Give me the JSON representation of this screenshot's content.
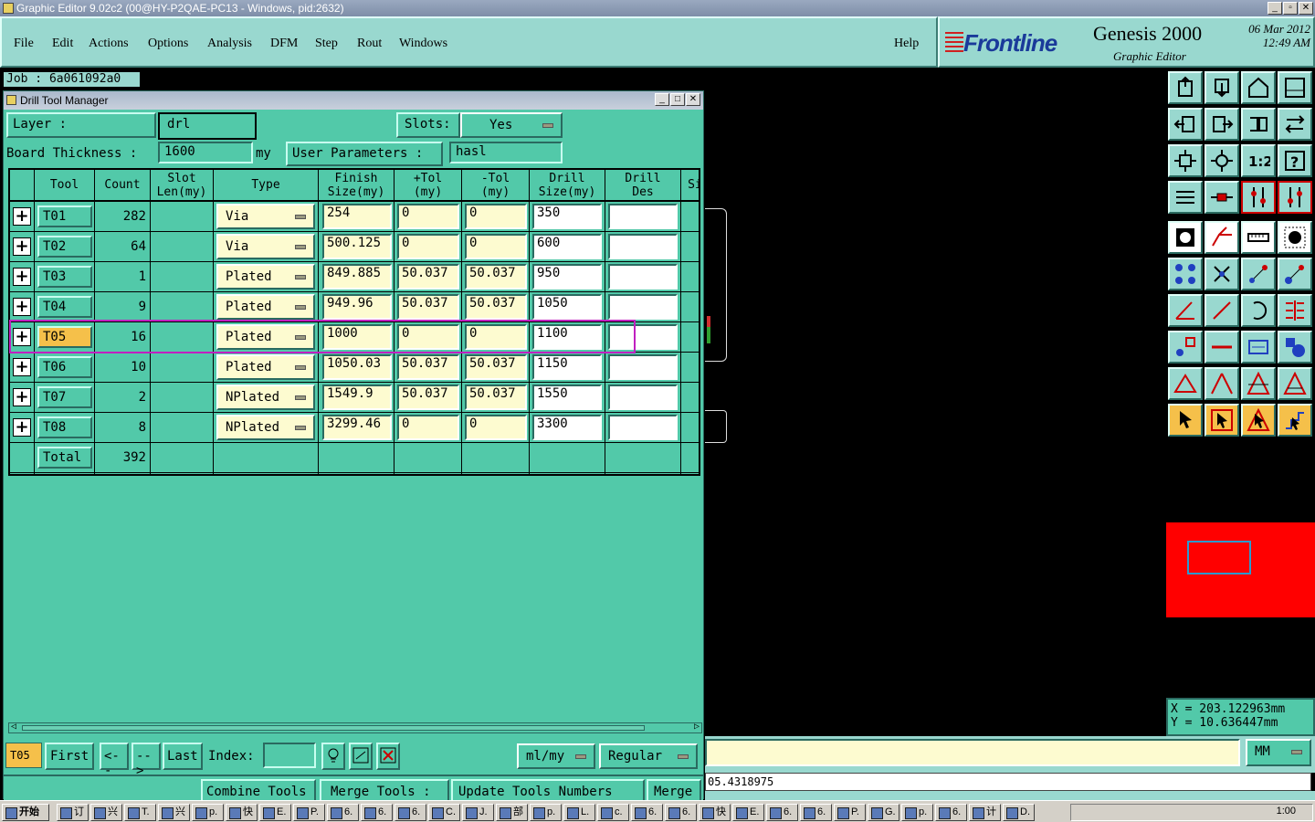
{
  "window": {
    "title": "Graphic Editor 9.02c2 (00@HY-P2QAE-PC13 - Windows, pid:2632)"
  },
  "menu": [
    "File",
    "Edit",
    "Actions",
    "Options",
    "Analysis",
    "DFM",
    "Step",
    "Rout",
    "Windows"
  ],
  "help_label": "Help",
  "logo": {
    "brand": "Frontline",
    "product": "Genesis 2000",
    "sub": "Graphic Editor",
    "date": "06 Mar 2012",
    "time": "12:49 AM"
  },
  "job": "Job : 6a061092a0",
  "dtm": {
    "title": "Drill Tool Manager",
    "layer_label": "Layer           :",
    "layer_value": "drl",
    "slots_label": "Slots:",
    "slots_value": "Yes",
    "board_label": "Board Thickness :",
    "board_value": "1600",
    "board_unit": "my",
    "user_params_label": "User Parameters :",
    "user_params_value": "hasl",
    "columns": [
      "Tool",
      "Count",
      "Slot\nLen(my)",
      "Type",
      "Finish\nSize(my)",
      "+Tol\n(my)",
      "-Tol\n(my)",
      "Drill\nSize(my)",
      "Drill\nDes",
      "Si"
    ],
    "rows": [
      {
        "tool": "T01",
        "count": "282",
        "type": "Via",
        "finish": "254",
        "ptol": "0",
        "mtol": "0",
        "drill": "350"
      },
      {
        "tool": "T02",
        "count": "64",
        "type": "Via",
        "finish": "500.125",
        "ptol": "0",
        "mtol": "0",
        "drill": "600"
      },
      {
        "tool": "T03",
        "count": "1",
        "type": "Plated",
        "finish": "849.885",
        "ptol": "50.037",
        "mtol": "50.037",
        "drill": "950"
      },
      {
        "tool": "T04",
        "count": "9",
        "type": "Plated",
        "finish": "949.96",
        "ptol": "50.037",
        "mtol": "50.037",
        "drill": "1050"
      },
      {
        "tool": "T05",
        "count": "16",
        "type": "Plated",
        "finish": "1000",
        "ptol": "0",
        "mtol": "0",
        "drill": "1100"
      },
      {
        "tool": "T06",
        "count": "10",
        "type": "Plated",
        "finish": "1050.03",
        "ptol": "50.037",
        "mtol": "50.037",
        "drill": "1150"
      },
      {
        "tool": "T07",
        "count": "2",
        "type": "NPlated",
        "finish": "1549.9",
        "ptol": "50.037",
        "mtol": "50.037",
        "drill": "1550"
      },
      {
        "tool": "T08",
        "count": "8",
        "type": "NPlated",
        "finish": "3299.46",
        "ptol": "0",
        "mtol": "0",
        "drill": "3300"
      }
    ],
    "total_label": "Total",
    "total_count": "392",
    "selected": "T05",
    "nav": {
      "first": "First",
      "prev": "<--",
      "next": "-->",
      "last": "Last",
      "index_label": "Index:",
      "units": "ml/my",
      "mode": "Regular"
    },
    "bottom_buttons": [
      "Combine Tools",
      "Merge Tools :",
      "Update Tools Numbers",
      "Merge"
    ]
  },
  "coords": {
    "x": "X = 203.122963mm",
    "y": "Y = 10.636447mm"
  },
  "units_dd": "MM",
  "status_value": "05.4318975",
  "taskbar": {
    "start": "开始",
    "items": [
      "订",
      "兴",
      "T.",
      "兴",
      "p.",
      "快",
      "E.",
      "P.",
      "6.",
      "6.",
      "6.",
      "C.",
      "J.",
      "部",
      "p.",
      "L.",
      "c.",
      "6.",
      "6.",
      "快",
      "E.",
      "6.",
      "6.",
      "P.",
      "G.",
      "p.",
      "6.",
      "计",
      "D."
    ],
    "clock": "1:00"
  },
  "colors": {
    "panel": "#52c9a9",
    "menubar": "#99d8cf",
    "highlight": "#f5c04a",
    "selection_box": "#c020c0",
    "minimap": "#ff0000"
  }
}
